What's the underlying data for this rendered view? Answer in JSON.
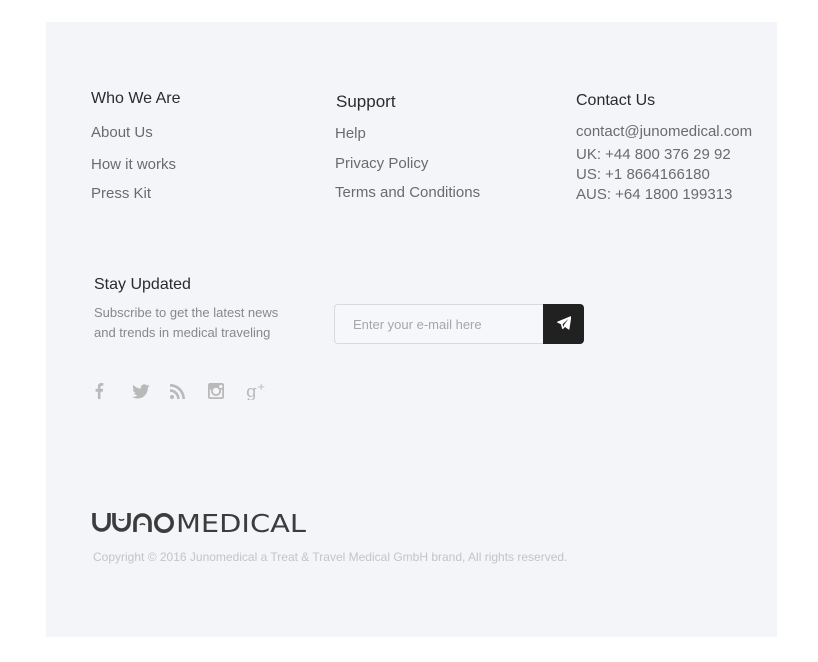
{
  "who_we_are": {
    "title": "Who We Are",
    "links": [
      "About Us",
      "How it works",
      "Press Kit"
    ]
  },
  "support": {
    "title": "Support",
    "links": [
      "Help",
      "Privacy Policy",
      "Terms and Conditions"
    ]
  },
  "contact": {
    "title": "Contact Us",
    "email": "contact@junomedical.com",
    "phones": [
      "UK: +44 800 376 29 92",
      "US: +1 8664166180",
      "AUS: +64 1800 199313"
    ]
  },
  "stay_updated": {
    "title": "Stay Updated",
    "description": "Subscribe to get the latest news and trends in medical traveling",
    "social_icons": [
      "facebook-icon",
      "twitter-icon",
      "rss-icon",
      "instagram-icon",
      "google-plus-icon"
    ],
    "email_placeholder": "Enter your e-mail here",
    "submit_icon": "send-icon"
  },
  "brand": {
    "logo_text": "JUNOMEDICAL",
    "copyright": "Copyright © 2016 Junomedical a Treat & Travel Medical GmbH brand, All rights reserved."
  },
  "colors": {
    "background": "#f4f5f9",
    "button": "#212121",
    "link": "#6b6b6b"
  }
}
